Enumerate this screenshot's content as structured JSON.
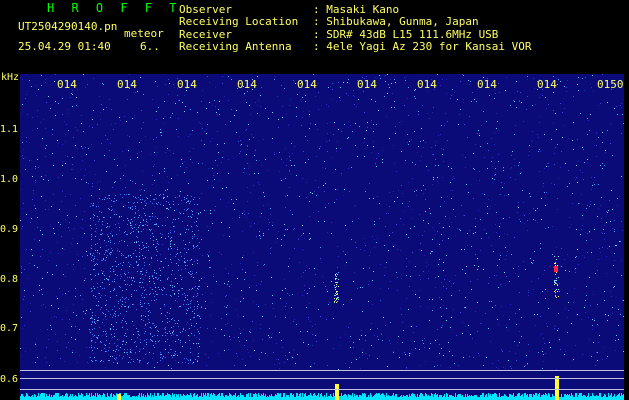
{
  "header": {
    "brand": "H R O F F T",
    "filename": "UT2504290140.pn",
    "mode": "meteor",
    "datetime": "25.04.29 01:40",
    "count": "6..",
    "observer_key": "Observer",
    "observer_val": ": Masaki Kano",
    "location_key": "Receiving Location",
    "location_val": ": Shibukawa, Gunma, Japan",
    "receiver_key": "Receiver",
    "receiver_val": ": SDR# 43dB L15 111.6MHz USB",
    "antenna_key": "Receiving Antenna",
    "antenna_val": ": 4ele Yagi Az 230 for Kansai VOR"
  },
  "axis": {
    "unit": "kHz",
    "y_ticks": [
      "1.1",
      "1.0",
      "0.9",
      "0.8",
      "0.7",
      "0.6"
    ],
    "x_ticks": [
      "014",
      "014",
      "014",
      "014",
      "014",
      "014",
      "014",
      "014",
      "014",
      "0150"
    ]
  },
  "colors": {
    "background": "#0a0a78",
    "text": "#ffff66",
    "brand": "#00ff00",
    "noise": "#00e5ff",
    "echo_core": "#ff2244"
  }
}
